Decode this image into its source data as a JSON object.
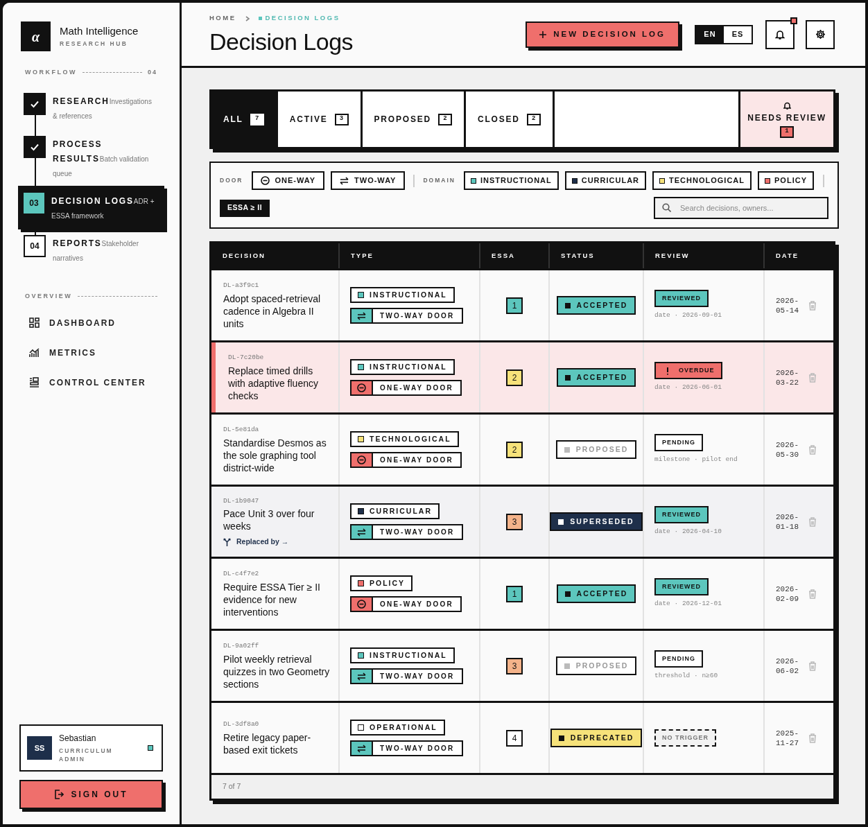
{
  "brand": {
    "logo": "α",
    "title": "Math Intelligence",
    "subtitle": "RESEARCH HUB"
  },
  "workflow": {
    "label": "WORKFLOW",
    "count": "04",
    "steps": [
      {
        "done": true,
        "current": false,
        "title": "RESEARCH",
        "note": "Investigations & references"
      },
      {
        "done": true,
        "current": false,
        "title": "PROCESS RESULTS",
        "note": "Batch validation queue"
      },
      {
        "done": false,
        "current": true,
        "number": "03",
        "title": "DECISION LOGS",
        "note": "ADR + ESSA framework"
      },
      {
        "done": false,
        "current": false,
        "number": "04",
        "title": "REPORTS",
        "note": "Stakeholder narratives"
      }
    ]
  },
  "overview": {
    "label": "OVERVIEW",
    "items": [
      {
        "label": "DASHBOARD"
      },
      {
        "label": "METRICS"
      },
      {
        "label": "CONTROL CENTER"
      }
    ]
  },
  "user": {
    "initials": "SS",
    "name": "Sebastian",
    "role": "CURRICULUM ADMIN",
    "online": true
  },
  "sign_out": "SIGN OUT",
  "breadcrumb": [
    {
      "label": "HOME",
      "current": false
    },
    {
      "label": "DECISION LOGS",
      "current": true
    }
  ],
  "title": "Decision Logs",
  "new_button": "NEW DECISION LOG",
  "languages": [
    {
      "label": "EN",
      "selected": true
    },
    {
      "label": "ES",
      "selected": false
    }
  ],
  "notifications": {
    "unread": true
  },
  "tabs": [
    {
      "kind": "tab",
      "label": "ALL",
      "count": "7",
      "selected": true
    },
    {
      "kind": "tab",
      "label": "ACTIVE",
      "count": "3",
      "selected": false
    },
    {
      "kind": "tab",
      "label": "PROPOSED",
      "count": "2",
      "selected": false
    },
    {
      "kind": "tab",
      "label": "CLOSED",
      "count": "2",
      "selected": false
    },
    {
      "kind": "alert",
      "label": "NEEDS REVIEW",
      "count": "1",
      "selected": false
    }
  ],
  "filters": {
    "door_label": "DOOR",
    "doors": [
      {
        "kind": "one-way",
        "label": "ONE-WAY"
      },
      {
        "kind": "two-way",
        "label": "TWO-WAY"
      }
    ],
    "domain_label": "DOMAIN",
    "domains": [
      {
        "label": "INSTRUCTIONAL",
        "color": "#5cc6bd"
      },
      {
        "label": "CURRICULAR",
        "color": "#1e2f4a"
      },
      {
        "label": "TECHNOLOGICAL",
        "color": "#f6e27a"
      },
      {
        "label": "POLICY",
        "color": "#ef6f6c"
      }
    ],
    "essa": {
      "label": "ESSA ≥ II",
      "active": true
    },
    "search": {
      "placeholder": "Search decisions, owners..."
    }
  },
  "table": {
    "columns": [
      "DECISION",
      "TYPE",
      "ESSA",
      "STATUS",
      "REVIEW",
      "DATE"
    ],
    "rows": [
      {
        "id": "DL-a3f9c1",
        "title": "Adopt spaced-retrieval cadence in Algebra II units",
        "domain": {
          "label": "INSTRUCTIONAL",
          "color": "#5cc6bd"
        },
        "door": {
          "kind": "two-way",
          "label": "TWO-WAY DOOR"
        },
        "essa": {
          "value": "1",
          "color": "#5cc6bd"
        },
        "status": {
          "kind": "accepted",
          "label": "ACCEPTED"
        },
        "review": {
          "kind": "reviewed",
          "label": "REVIEWED",
          "note": "date · 2026-09-01"
        },
        "date": "2026-05-14",
        "highlighted": false
      },
      {
        "id": "DL-7c20be",
        "title": "Replace timed drills with adaptive fluency checks",
        "domain": {
          "label": "INSTRUCTIONAL",
          "color": "#5cc6bd"
        },
        "door": {
          "kind": "one-way",
          "label": "ONE-WAY DOOR"
        },
        "essa": {
          "value": "2",
          "color": "#f6e27a"
        },
        "status": {
          "kind": "accepted",
          "label": "ACCEPTED"
        },
        "review": {
          "kind": "overdue",
          "label": "OVERDUE",
          "note": "date · 2026-06-01"
        },
        "date": "2026-03-22",
        "highlighted": true
      },
      {
        "id": "DL-5e81da",
        "title": "Standardise Desmos as the sole graphing tool district-wide",
        "domain": {
          "label": "TECHNOLOGICAL",
          "color": "#f6e27a"
        },
        "door": {
          "kind": "one-way",
          "label": "ONE-WAY DOOR"
        },
        "essa": {
          "value": "2",
          "color": "#f6e27a"
        },
        "status": {
          "kind": "proposed",
          "label": "PROPOSED"
        },
        "review": {
          "kind": "pending",
          "label": "PENDING",
          "note": "milestone · pilot end"
        },
        "date": "2026-05-30",
        "highlighted": false
      },
      {
        "id": "DL-1b9047",
        "title": "Pace Unit 3 over four weeks",
        "link": "Replaced by →",
        "domain": {
          "label": "CURRICULAR",
          "color": "#1e2f4a"
        },
        "door": {
          "kind": "two-way",
          "label": "TWO-WAY DOOR"
        },
        "essa": {
          "value": "3",
          "color": "#f4b38a"
        },
        "status": {
          "kind": "superseded",
          "label": "SUPERSEDED"
        },
        "review": {
          "kind": "reviewed",
          "label": "REVIEWED",
          "note": "date · 2026-04-10"
        },
        "date": "2026-01-18",
        "highlighted": false
      },
      {
        "id": "DL-c4f7e2",
        "title": "Require ESSA Tier ≥ II evidence for new interventions",
        "domain": {
          "label": "POLICY",
          "color": "#ef6f6c"
        },
        "door": {
          "kind": "one-way",
          "label": "ONE-WAY DOOR"
        },
        "essa": {
          "value": "1",
          "color": "#5cc6bd"
        },
        "status": {
          "kind": "accepted",
          "label": "ACCEPTED"
        },
        "review": {
          "kind": "reviewed",
          "label": "REVIEWED",
          "note": "date · 2026-12-01"
        },
        "date": "2026-02-09",
        "highlighted": false
      },
      {
        "id": "DL-9a02ff",
        "title": "Pilot weekly retrieval quizzes in two Geometry sections",
        "domain": {
          "label": "INSTRUCTIONAL",
          "color": "#5cc6bd"
        },
        "door": {
          "kind": "two-way",
          "label": "TWO-WAY DOOR"
        },
        "essa": {
          "value": "3",
          "color": "#f4b38a"
        },
        "status": {
          "kind": "proposed",
          "label": "PROPOSED"
        },
        "review": {
          "kind": "pending",
          "label": "PENDING",
          "note": "threshold · n≥60"
        },
        "date": "2026-06-02",
        "highlighted": false
      },
      {
        "id": "DL-3df8a0",
        "title": "Retire legacy paper-based exit tickets",
        "domain": {
          "label": "OPERATIONAL",
          "color": "#ffffff"
        },
        "door": {
          "kind": "two-way",
          "label": "TWO-WAY DOOR"
        },
        "essa": {
          "value": "4",
          "color": "#ffffff"
        },
        "status": {
          "kind": "deprecated",
          "label": "DEPRECATED"
        },
        "review": {
          "kind": "none",
          "label": "NO TRIGGER"
        },
        "date": "2025-11-27",
        "highlighted": false
      }
    ],
    "footer": "7 of 7"
  }
}
